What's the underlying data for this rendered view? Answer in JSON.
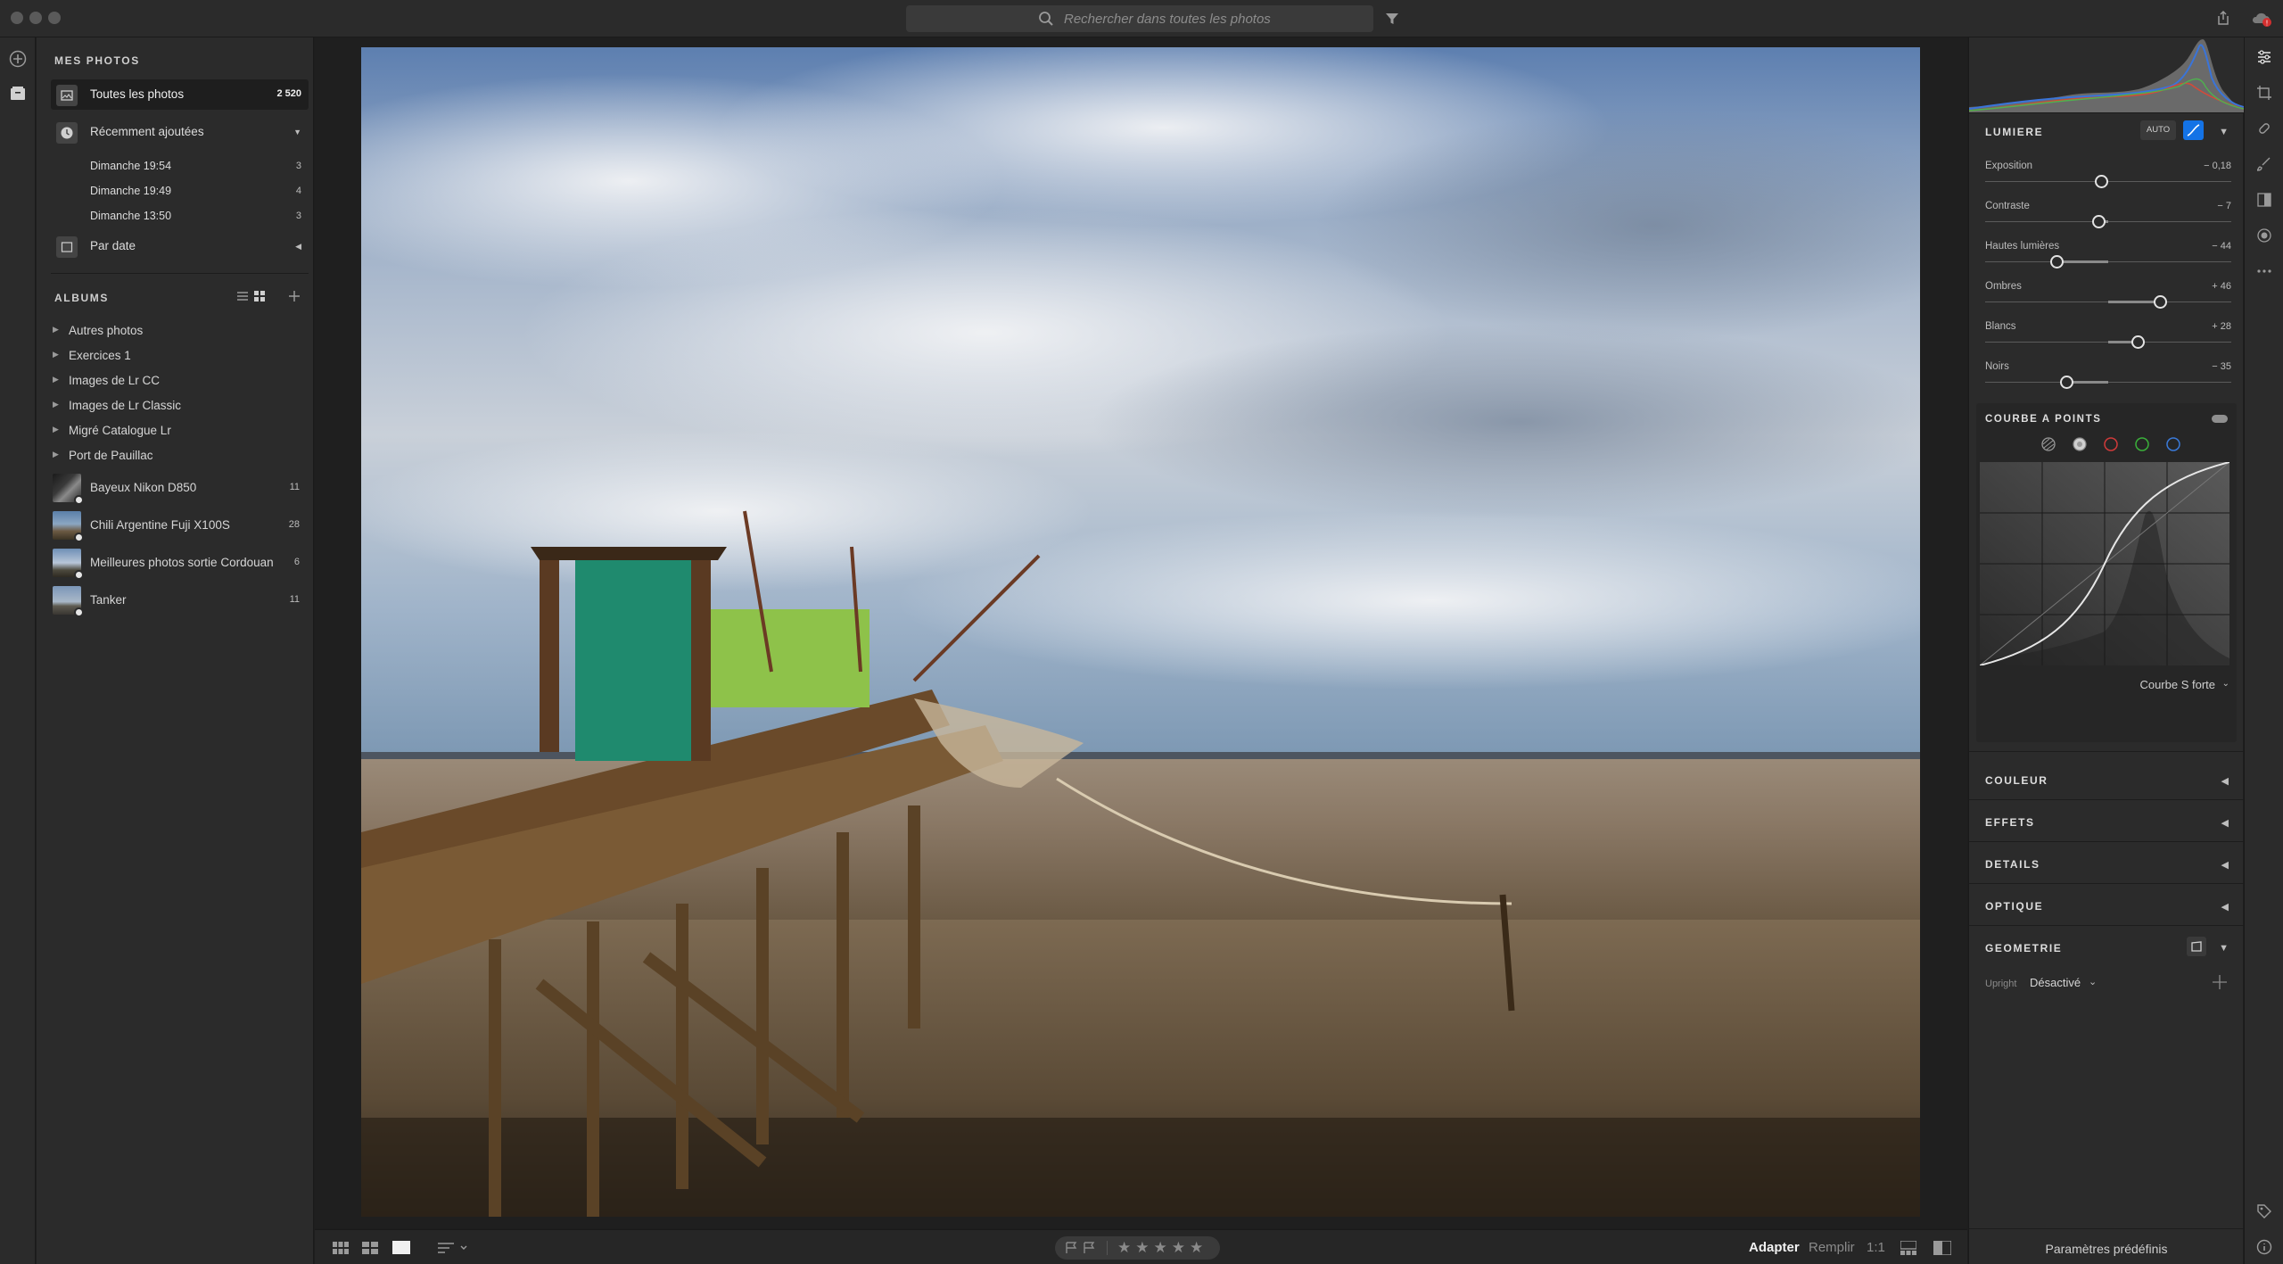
{
  "search": {
    "placeholder": "Rechercher dans toutes les photos"
  },
  "sidebar": {
    "my_photos_title": "MES PHOTOS",
    "all_photos": {
      "label": "Toutes les photos",
      "count": "2 520"
    },
    "recent": {
      "label": "Récemment ajoutées"
    },
    "recent_items": [
      {
        "label": "Dimanche 19:54",
        "count": "3"
      },
      {
        "label": "Dimanche 19:49",
        "count": "4"
      },
      {
        "label": "Dimanche 13:50",
        "count": "3"
      }
    ],
    "by_date": {
      "label": "Par date"
    },
    "albums_title": "ALBUMS",
    "folders": [
      {
        "label": "Autres photos"
      },
      {
        "label": "Exercices 1"
      },
      {
        "label": "Images de Lr CC"
      },
      {
        "label": "Images de Lr Classic"
      },
      {
        "label": "Migré Catalogue Lr"
      },
      {
        "label": "Port de Pauillac"
      }
    ],
    "albums": [
      {
        "label": "Bayeux Nikon D850",
        "count": "11"
      },
      {
        "label": "Chili Argentine Fuji X100S",
        "count": "28"
      },
      {
        "label": "Meilleures photos sortie Cordouan",
        "count": "6"
      },
      {
        "label": "Tanker",
        "count": "11"
      }
    ]
  },
  "bottom": {
    "zoom_fit": "Adapter",
    "zoom_fill": "Remplir",
    "zoom_1to1": "1:1",
    "stars": "★★★★★"
  },
  "edit": {
    "light_title": "LUMIERE",
    "auto_label": "AUTO",
    "sliders": [
      {
        "label": "Exposition",
        "value": "− 0,18",
        "pos": 0.47
      },
      {
        "label": "Contraste",
        "value": "− 7",
        "pos": 0.46
      },
      {
        "label": "Hautes lumières",
        "value": "− 44",
        "pos": 0.29
      },
      {
        "label": "Ombres",
        "value": "+ 46",
        "pos": 0.71
      },
      {
        "label": "Blancs",
        "value": "+ 28",
        "pos": 0.62
      },
      {
        "label": "Noirs",
        "value": "− 35",
        "pos": 0.33
      }
    ],
    "curve_title": "COURBE A POINTS",
    "curve_preset": "Courbe S forte",
    "color_title": "COULEUR",
    "effects_title": "EFFETS",
    "details_title": "DETAILS",
    "optics_title": "OPTIQUE",
    "geometry_title": "GEOMETRIE",
    "upright_label": "Upright",
    "upright_value": "Désactivé",
    "presets_label": "Paramètres prédéfinis"
  },
  "colors": {
    "accent": "#1473e6",
    "panel": "#2b2b2b",
    "selected": "#1e1e1e"
  }
}
